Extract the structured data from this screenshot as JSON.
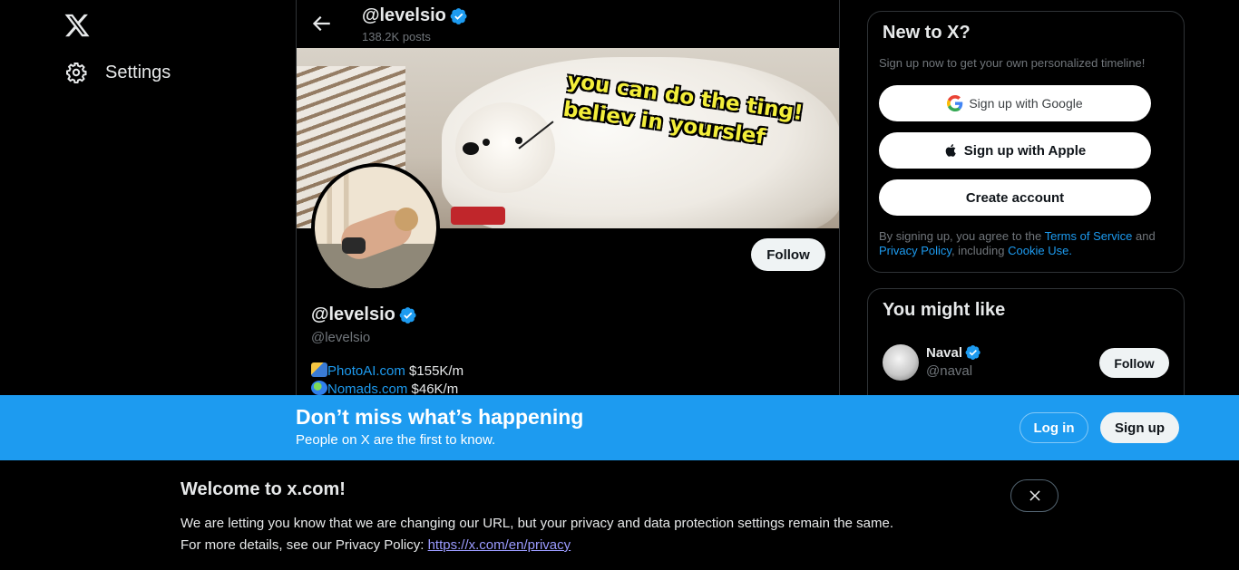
{
  "nav": {
    "settings_label": "Settings"
  },
  "profile": {
    "header_name": "@levelsio",
    "post_count": "138.2K posts",
    "display_name": "@levelsio",
    "handle": "@levelsio",
    "follow_label": "Follow",
    "banner_meme_line1": "you can do the ting!",
    "banner_meme_line2": "believ in yourslef",
    "bio": [
      {
        "icon": "camera-flash-emoji",
        "link": "PhotoAI.com",
        "text": " $155K/m"
      },
      {
        "icon": "globe-emoji",
        "link": "Nomads.com",
        "text": " $46K/m"
      }
    ]
  },
  "signup_card": {
    "title": "New to X?",
    "subtitle": "Sign up now to get your own personalized timeline!",
    "google_label": "Sign up with Google",
    "apple_label": "Sign up with Apple",
    "create_label": "Create account",
    "legal_prefix": "By signing up, you agree to the ",
    "terms_link": "Terms of Service",
    "legal_and": " and ",
    "privacy_link": "Privacy Policy",
    "legal_including": ", including ",
    "cookie_link": "Cookie Use",
    "legal_end": "."
  },
  "suggestions": {
    "title": "You might like",
    "items": [
      {
        "name": "Naval",
        "handle": "@naval",
        "follow_label": "Follow"
      }
    ]
  },
  "bottom_bar": {
    "title": "Don’t miss what’s happening",
    "subtitle": "People on X are the first to know.",
    "login_label": "Log in",
    "signup_label": "Sign up"
  },
  "welcome": {
    "title": "Welcome to x.com!",
    "line1": "We are letting you know that we are changing our URL, but your privacy and data protection settings remain the same.",
    "line2_prefix": "For more details, see our Privacy Policy: ",
    "privacy_url": "https://x.com/en/privacy"
  },
  "colors": {
    "accent": "#1d9bf0",
    "background": "#000000",
    "text": "#e7e9ea",
    "muted": "#71767b",
    "border": "#2f3336"
  }
}
